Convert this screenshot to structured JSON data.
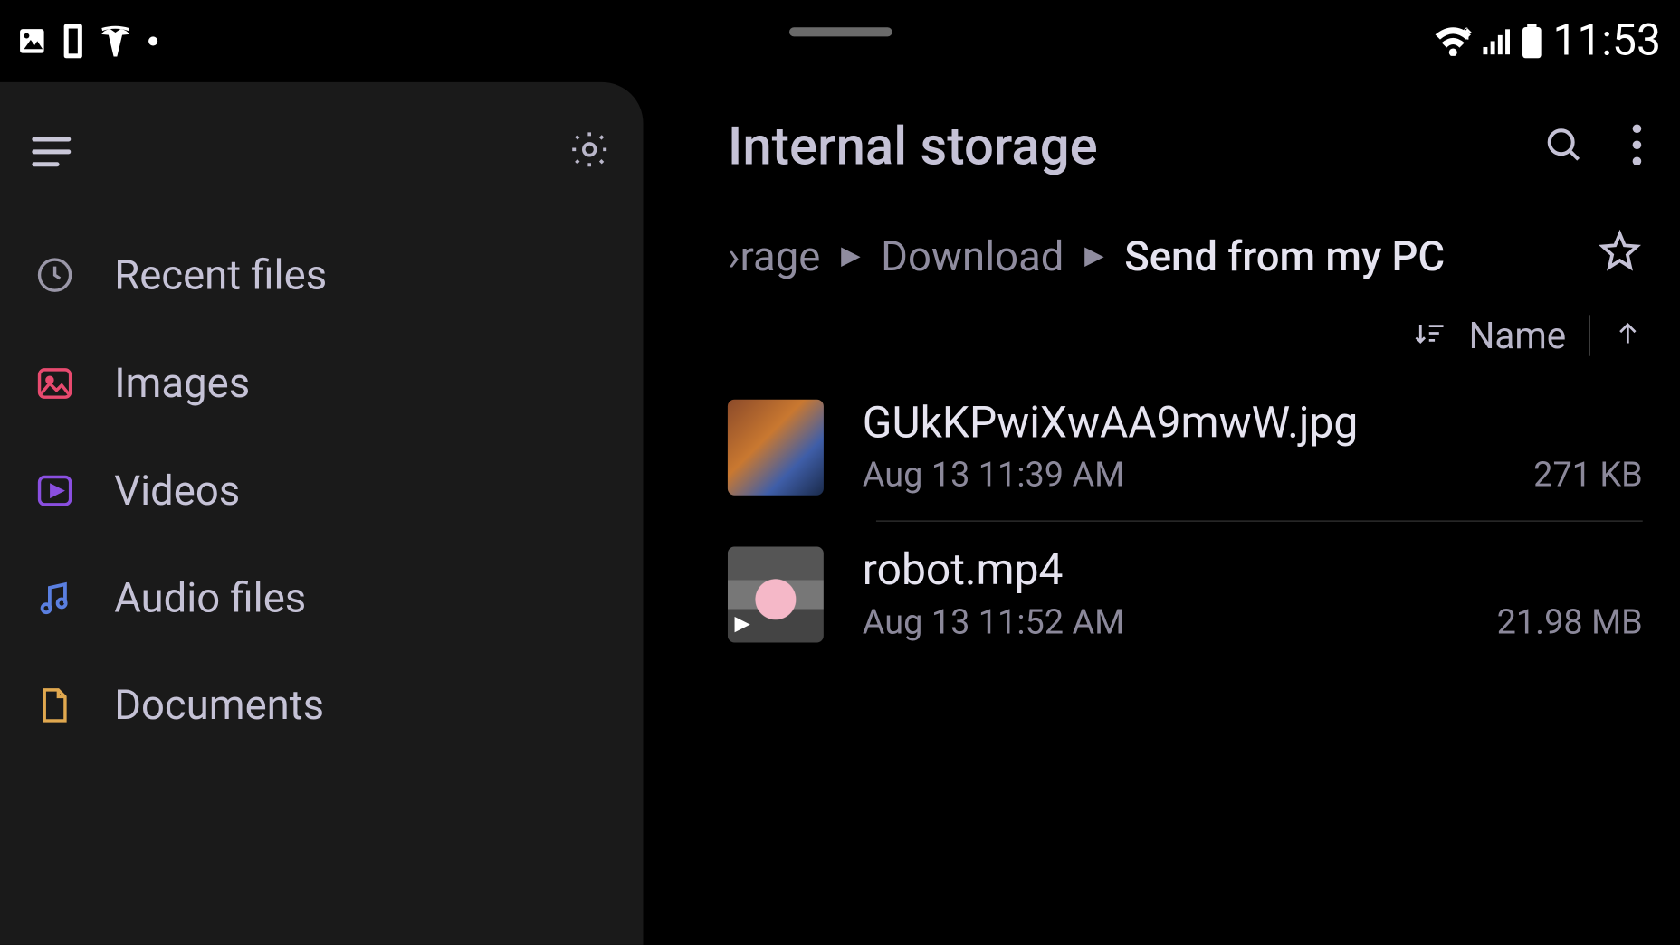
{
  "statusbar": {
    "time": "11:53"
  },
  "sidebar": {
    "recent_label": "Recent files",
    "images_label": "Images",
    "videos_label": "Videos",
    "audio_label": "Audio files",
    "documents_label": "Documents"
  },
  "header": {
    "title": "Internal storage"
  },
  "breadcrumb": {
    "part_storage": "›rage",
    "part_download": "Download",
    "part_current": "Send from my PC"
  },
  "sort": {
    "label": "Name"
  },
  "files": [
    {
      "name": "GUkKPwiXwAA9mwW.jpg",
      "date": "Aug 13 11:39 AM",
      "size": "271 KB"
    },
    {
      "name": "robot.mp4",
      "date": "Aug 13 11:52 AM",
      "size": "21.98 MB"
    }
  ]
}
